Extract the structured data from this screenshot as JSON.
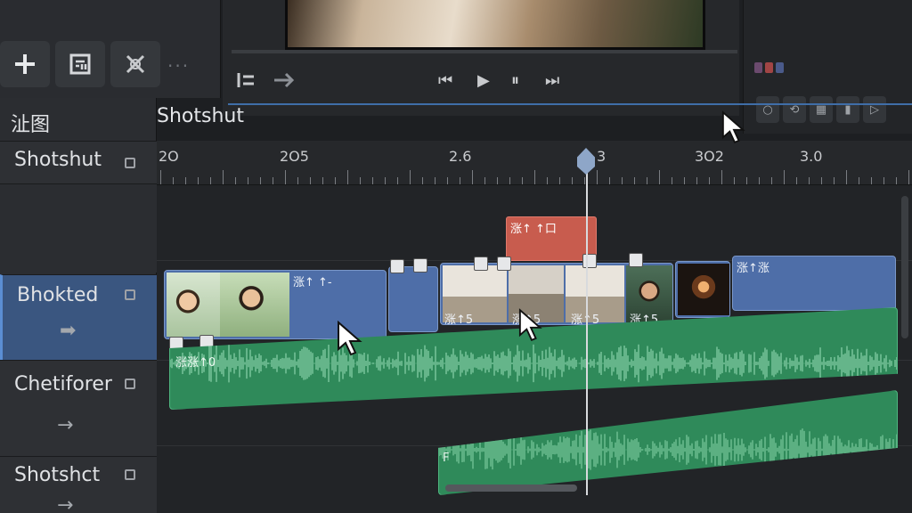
{
  "toolbar": {
    "add_icon": "plus-icon",
    "storyboard_icon": "storyboard-icon",
    "tools_icon": "tools-icon",
    "more_label": "···"
  },
  "transport": {
    "list_icon": "list-icon",
    "arrow_icon": "arrow-right-icon",
    "rewind_label": "⏮",
    "play_label": "▶",
    "pause_label": "⏸",
    "forward_label": "⏭"
  },
  "panel": {
    "title": "沚图",
    "timeline_title": "Shotshut"
  },
  "tracks": [
    {
      "name": "Shotshut",
      "selected": false
    },
    {
      "name": "Bhokted",
      "selected": true
    },
    {
      "name": "Chetiforer",
      "selected": false
    },
    {
      "name": "Shotshct",
      "selected": false
    }
  ],
  "ruler": {
    "labels": [
      "2O",
      "2O5",
      "2.6",
      "3",
      "3O2",
      "3.0"
    ]
  },
  "clips": {
    "red_label": "涨↑ ↑口",
    "video_labels": [
      "涨↑ ↑-",
      "涨↑5",
      "涨↑5",
      "涨↑5",
      "涨↑5",
      "涨↑涨"
    ],
    "audio_label": "涨涨↑0",
    "audio2_label": "F"
  },
  "colors": {
    "video": "#4e6ea8",
    "audio": "#2f8a5a",
    "selected_track": "#3a5680",
    "playhead_cap": "#8ea6c8",
    "range_bar": "#c9c438"
  }
}
